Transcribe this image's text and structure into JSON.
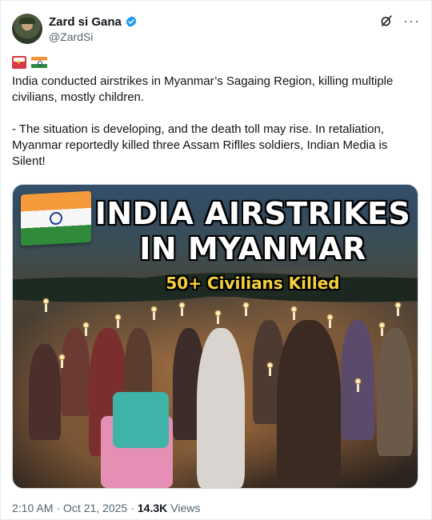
{
  "author": {
    "display_name": "Zard si Gana",
    "handle": "@ZardSi",
    "verified": true
  },
  "flags": [
    "flag-myanmar",
    "flag-india"
  ],
  "tweet": {
    "paragraph_1": "India conducted airstrikes in Myanmar’s Sagaing Region, killing multiple civilians, mostly children.",
    "paragraph_2": "- The situation is developing, and the death toll may rise. In retaliation, Myanmar reportedly killed three Assam Riflles soldiers, Indian Media is Silent!"
  },
  "media": {
    "headline_line_1": "INDIA AIRSTRIKES",
    "headline_line_2": "IN MYANMAR",
    "subheadline": "50+ Civilians Killed"
  },
  "meta": {
    "time": "2:10 AM",
    "separator": "·",
    "date": "Oct 21, 2025",
    "views_count": "14.3K",
    "views_label": "Views"
  },
  "colors": {
    "text_primary": "#0f1419",
    "text_secondary": "#536471",
    "verified_blue": "#1d9bf0",
    "subheadline_yellow": "#f6d13a"
  },
  "icons": {
    "verified": "verified-badge-icon",
    "grok": "grok-icon",
    "more": "more-icon"
  }
}
